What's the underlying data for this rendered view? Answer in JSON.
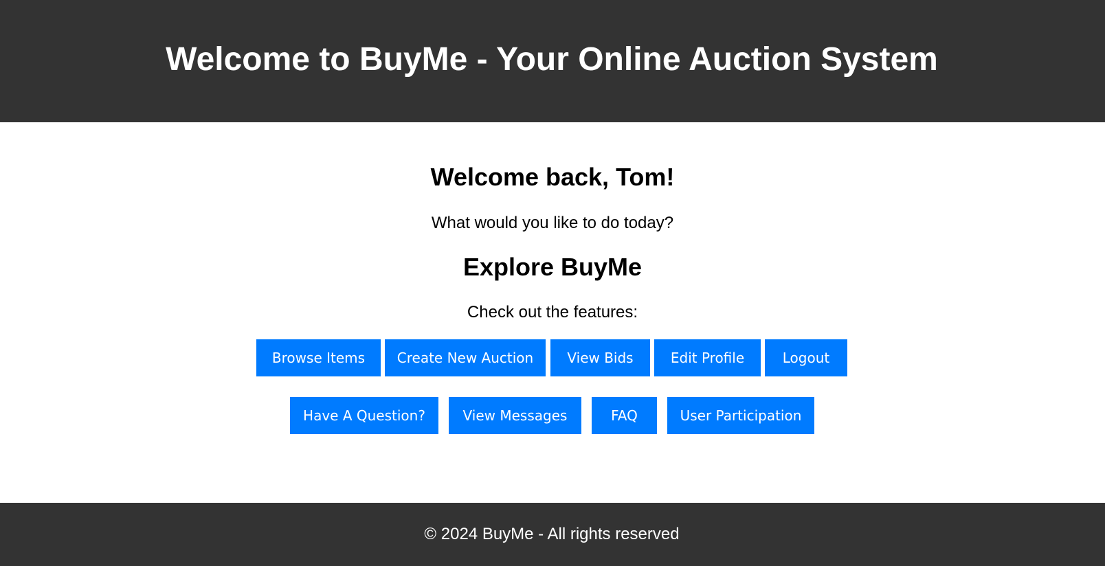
{
  "header": {
    "title": "Welcome to BuyMe - Your Online Auction System"
  },
  "main": {
    "welcome": "Welcome back, Tom!",
    "prompt": "What would you like to do today?",
    "explore_heading": "Explore BuyMe",
    "features_text": "Check out the features:",
    "buttons_row1": [
      {
        "label": "Browse Items"
      },
      {
        "label": "Create New Auction"
      },
      {
        "label": "View Bids"
      },
      {
        "label": "Edit Profile"
      },
      {
        "label": "Logout"
      }
    ],
    "buttons_row2": [
      {
        "label": "Have A Question?"
      },
      {
        "label": "View Messages"
      },
      {
        "label": "FAQ"
      },
      {
        "label": "User Participation"
      }
    ]
  },
  "footer": {
    "text": "© 2024 BuyMe - All rights reserved"
  },
  "colors": {
    "header_bg": "#333333",
    "button_bg": "#007bff",
    "text_light": "#ffffff"
  }
}
